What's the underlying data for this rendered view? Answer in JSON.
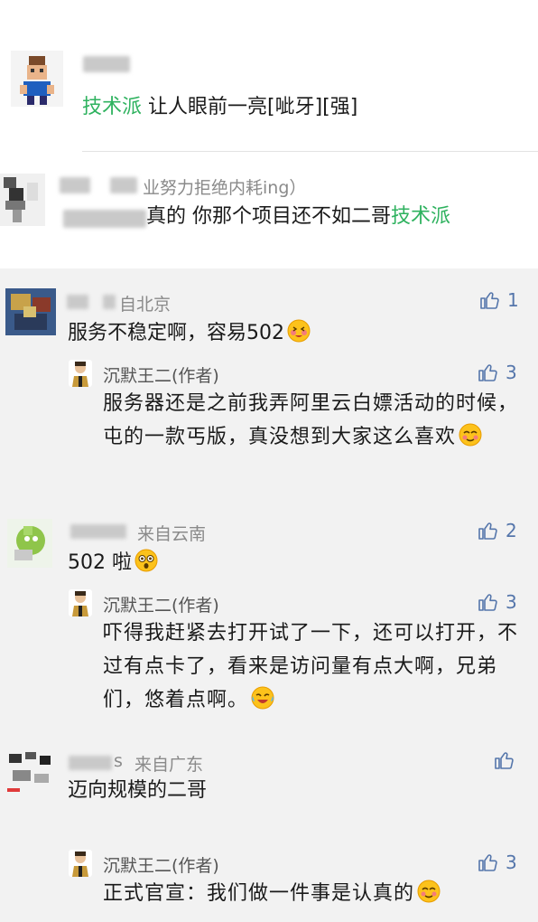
{
  "comments": [
    {
      "name_visible": "",
      "content_prefix": "技术派",
      "content_text": " 让人眼前一亮[呲牙][强]"
    },
    {
      "name_visible": "业努力拒绝内耗ing）",
      "content_prefix": " 真的 你那个项目还不如二哥",
      "content_link": "技术派"
    },
    {
      "location": "自北京",
      "content": "服务不稳定啊，容易502",
      "likes": "1",
      "reply": {
        "author": "沉默王二(作者)",
        "likes": "3",
        "content": "服务器还是之前我弄阿里云白嫖活动的时候，屯的一款丐版，真没想到大家这么喜欢"
      }
    },
    {
      "location": "来自云南",
      "content": "502 啦",
      "likes": "2",
      "reply": {
        "author": "沉默王二(作者)",
        "likes": "3",
        "content": "吓得我赶紧去打开试了一下，还可以打开，不过有点卡了，看来是访问量有点大啊，兄弟们，悠着点啊。"
      }
    },
    {
      "name_visible": "s",
      "location": "来自广东",
      "content": "迈向规模的二哥",
      "likes": "",
      "reply": {
        "author": "沉默王二(作者)",
        "likes": "3",
        "content": "正式官宣：我们做一件事是认真的"
      }
    }
  ],
  "colors": {
    "green_link": "#2fb25f",
    "like_blue": "#5576ab",
    "name_gray": "#8a8a8a",
    "reply_bg": "#f2f2f2"
  }
}
